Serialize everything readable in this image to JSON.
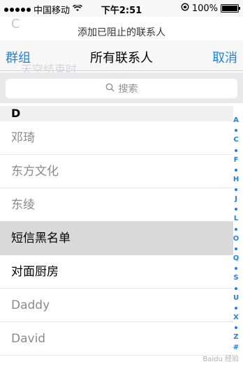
{
  "status_bar": {
    "carrier": "中国移动",
    "time": "下午2:51",
    "battery": "100%",
    "wifi_icon": "wifi-icon",
    "lock_icon": "rotation-lock-icon"
  },
  "sheet": {
    "faded_letter": "C",
    "title": "添加已阻止的联系人",
    "ghost_text": "天空结束时"
  },
  "nav": {
    "left": "群组",
    "title": "所有联系人",
    "right": "取消"
  },
  "search": {
    "placeholder": "搜索",
    "icon": "search-icon"
  },
  "section": {
    "letter": "D"
  },
  "contacts": [
    {
      "name": "邓琦",
      "style": "muted"
    },
    {
      "name": "东方文化",
      "style": "muted"
    },
    {
      "name": "东绫",
      "style": "muted"
    },
    {
      "name": "短信黑名单",
      "style": "selected"
    },
    {
      "name": "对面厨房",
      "style": "strong"
    },
    {
      "name": "Daddy",
      "style": "muted"
    },
    {
      "name": "David",
      "style": "muted"
    }
  ],
  "index_letters": [
    "A",
    "C",
    "F",
    "H",
    "J",
    "L",
    "O",
    "Q",
    "S",
    "U",
    "X",
    "Z",
    "#"
  ],
  "watermark": "Baidu 经验",
  "colors": {
    "accent": "#1a82f0",
    "muted_text": "#8a8a8a",
    "selected_row": "#d9d9d9"
  }
}
